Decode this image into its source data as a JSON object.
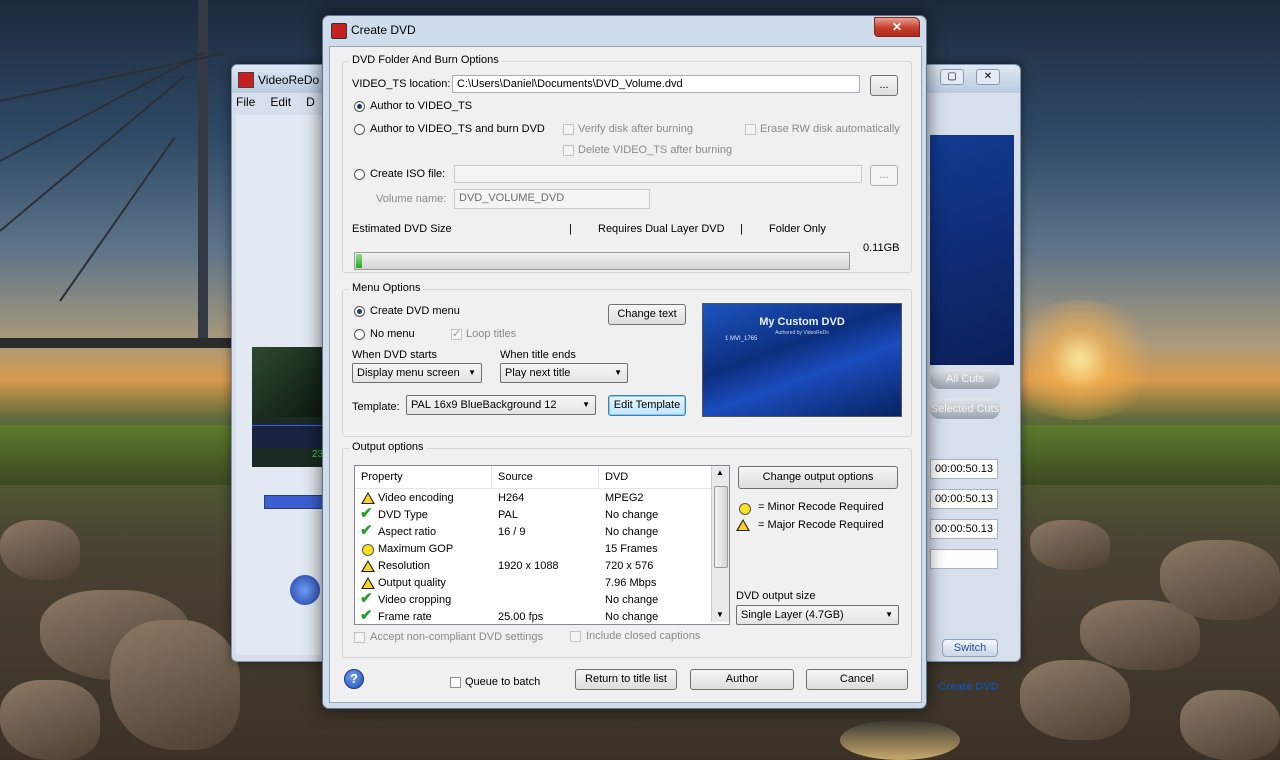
{
  "background_app": {
    "title": "VideoReDo",
    "menu": [
      "File",
      "Edit",
      "D"
    ],
    "buttons": [
      "All Cuts",
      "Selected Cuts"
    ],
    "times": [
      "00:00:50.13",
      "00:00:50.13",
      "00:00:50.13"
    ],
    "switch_label": "Switch",
    "create_dvd_link": "Create DVD",
    "thumb_timecode": "23"
  },
  "dialog": {
    "title": "Create DVD",
    "close_label": "✕",
    "folder_group": {
      "label": "DVD Folder And Burn Options",
      "video_ts_label": "VIDEO_TS location:",
      "video_ts_value": "C:\\Users\\Daniel\\Documents\\DVD_Volume.dvd",
      "browse_label": "...",
      "author_to_video_ts": "Author to VIDEO_TS",
      "author_and_burn": "Author to VIDEO_TS and burn DVD",
      "verify_disk": "Verify disk after burning",
      "erase_rw": "Erase RW disk automatically",
      "delete_video_ts": "Delete VIDEO_TS after burning",
      "create_iso": "Create ISO file:",
      "iso_value": "",
      "volume_name_label": "Volume name:",
      "volume_name_value": "DVD_VOLUME_DVD",
      "size_labels": [
        "Estimated DVD Size",
        "|",
        "Requires Dual Layer DVD",
        "|",
        "Folder Only"
      ],
      "size_value": "0.11GB",
      "size_fill_fraction": 0.012
    },
    "menu_group": {
      "label": "Menu Options",
      "create_menu": "Create DVD menu",
      "no_menu": "No menu",
      "loop_titles": "Loop titles",
      "change_text": "Change text",
      "when_starts_label": "When DVD starts",
      "when_starts_value": "Display menu screen",
      "when_ends_label": "When title ends",
      "when_ends_value": "Play next title",
      "template_label": "Template:",
      "template_value": "PAL 16x9 BlueBackground 12",
      "edit_template": "Edit Template",
      "preview_title": "My Custom DVD",
      "preview_subtitle": "Authored by VideoReDo",
      "preview_item": "1  MVI_1765"
    },
    "output_group": {
      "label": "Output options",
      "columns": [
        "Property",
        "Source",
        "DVD"
      ],
      "rows": [
        {
          "icon": "warning-icon",
          "property": "Video encoding",
          "source": "H264",
          "dvd": "MPEG2"
        },
        {
          "icon": "check-icon",
          "property": "DVD Type",
          "source": "PAL",
          "dvd": "No change"
        },
        {
          "icon": "check-icon",
          "property": "Aspect ratio",
          "source": "16 / 9",
          "dvd": "No change"
        },
        {
          "icon": "circle-icon",
          "property": "Maximum GOP",
          "source": "",
          "dvd": "15 Frames"
        },
        {
          "icon": "warning-icon",
          "property": "Resolution",
          "source": "1920 x 1088",
          "dvd": "720 x 576"
        },
        {
          "icon": "warning-icon",
          "property": "Output quality",
          "source": "",
          "dvd": "7.96 Mbps"
        },
        {
          "icon": "check-icon",
          "property": "Video cropping",
          "source": "",
          "dvd": "No change"
        },
        {
          "icon": "check-icon",
          "property": "Frame rate",
          "source": "25.00 fps",
          "dvd": "No change"
        }
      ],
      "change_output": "Change output options",
      "legend_minor": "= Minor Recode Required",
      "legend_major": "= Major Recode Required",
      "output_size_label": "DVD output size",
      "output_size_value": "Single Layer (4.7GB)",
      "accept_noncompliant": "Accept non-compliant DVD settings",
      "include_captions": "Include closed captions"
    },
    "footer": {
      "help": "?",
      "queue_to_batch": "Queue to batch",
      "return_to_list": "Return to title list",
      "author": "Author",
      "cancel": "Cancel"
    }
  }
}
